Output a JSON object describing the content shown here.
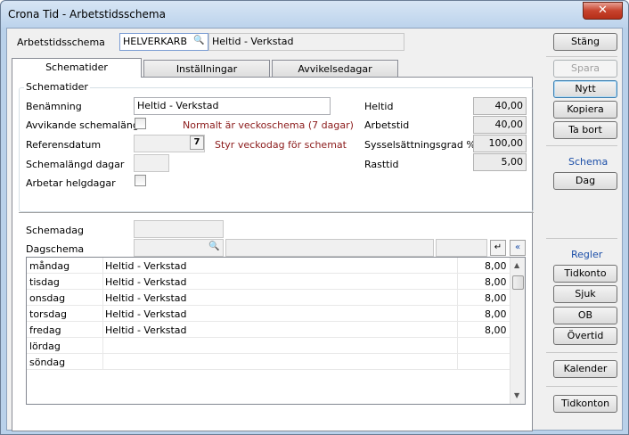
{
  "window": {
    "title": "Crona Tid - Arbetstidsschema",
    "close": "✕"
  },
  "header": {
    "label": "Arbetstidsschema",
    "code": "HELVERKARB",
    "name": "Heltid - Verkstad"
  },
  "tabs": [
    {
      "label": "Schematider"
    },
    {
      "label": "Inställningar"
    },
    {
      "label": "Avvikelsedagar"
    }
  ],
  "schematider": {
    "group_title": "Schematider",
    "benamning_label": "Benämning",
    "benamning_value": "Heltid - Verkstad",
    "avvikande_label": "Avvikande schemalängd",
    "avvikande_note": "Normalt är veckoschema (7 dagar)",
    "referensdatum_label": "Referensdatum",
    "referensdatum_note": "Styr veckodag för schemat",
    "schemalangd_label": "Schemalängd dagar",
    "helgdagar_label": "Arbetar helgdagar",
    "heltid_label": "Heltid",
    "heltid_value": "40,00",
    "arbetstid_label": "Arbetstid",
    "arbetstid_value": "40,00",
    "syssel_label": "Sysselsättningsgrad %",
    "syssel_value": "100,00",
    "rasttid_label": "Rasttid",
    "rasttid_value": "5,00",
    "cal_icon": "7"
  },
  "dag": {
    "schemadag_label": "Schemadag",
    "dagschema_label": "Dagschema"
  },
  "rows": [
    {
      "day": "måndag",
      "schema": "Heltid - Verkstad",
      "hours": "8,00"
    },
    {
      "day": "tisdag",
      "schema": "Heltid - Verkstad",
      "hours": "8,00"
    },
    {
      "day": "onsdag",
      "schema": "Heltid - Verkstad",
      "hours": "8,00"
    },
    {
      "day": "torsdag",
      "schema": "Heltid - Verkstad",
      "hours": "8,00"
    },
    {
      "day": "fredag",
      "schema": "Heltid - Verkstad",
      "hours": "8,00"
    },
    {
      "day": "lördag",
      "schema": "",
      "hours": ""
    },
    {
      "day": "söndag",
      "schema": "",
      "hours": ""
    }
  ],
  "sidebar": {
    "stang": "Stäng",
    "spara": "Spara",
    "nytt": "Nytt",
    "kopiera": "Kopiera",
    "ta_bort": "Ta bort",
    "schema_section": "Schema",
    "dag": "Dag",
    "regler_section": "Regler",
    "tidkonto": "Tidkonto",
    "sjuk": "Sjuk",
    "ob": "OB",
    "overtid": "Övertid",
    "kalender": "Kalender",
    "tidkonton": "Tidkonton"
  }
}
